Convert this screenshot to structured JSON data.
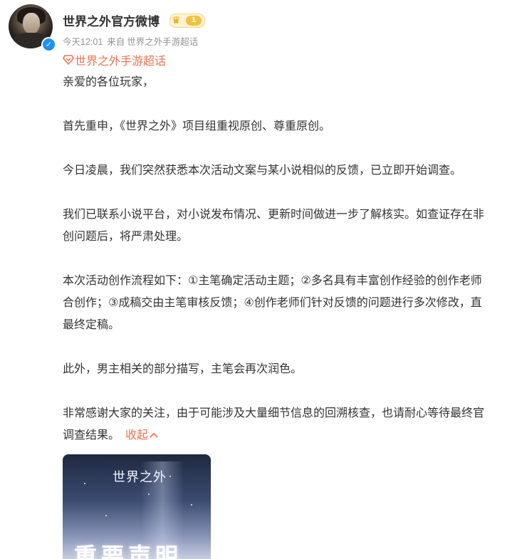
{
  "post": {
    "author": "世界之外官方微博",
    "level": "1",
    "time": "今天12:01",
    "source_prefix": "来自",
    "source": "世界之外手游超话",
    "supertopic": "世界之外手游超话",
    "paragraphs": [
      [
        "亲爱的各位玩家，"
      ],
      [
        "首先重申，《世界之外》项目组重视原创、尊重原创。"
      ],
      [
        "今日凌晨，我们突然获悉本次活动文案与某小说相似的反馈，已立即开始调查。"
      ],
      [
        "我们已联系小说平台，对小说发布情况、更新时间做进一步了解核实。如查证存在非",
        "创问题后，将严肃处理。"
      ],
      [
        "本次活动创作流程如下：①主笔确定活动主题；②多名具有丰富创作经验的创作老师",
        "合创作；③成稿交由主笔审核反馈；④创作老师们针对反馈的问题进行多次修改，直",
        "最终定稿。"
      ],
      [
        "此外，男主相关的部分描写，主笔会再次润色。"
      ],
      [
        "非常感谢大家的关注，由于可能涉及大量细节信息的回溯核查，也请耐心等待最终官",
        "调查结果。"
      ]
    ],
    "collapse_label": "收起",
    "image": {
      "logo_text": "世界之外",
      "headline": "重要声明"
    }
  },
  "colors": {
    "accent": "#eb7350",
    "meta": "#939393",
    "text": "#333333",
    "verified": "#1e90ff"
  },
  "icons": {
    "verified": "verified-check-icon",
    "level_badge": "crown-level-badge-icon",
    "supertopic": "supertopic-diamond-icon",
    "collapse": "chevron-up-icon"
  }
}
